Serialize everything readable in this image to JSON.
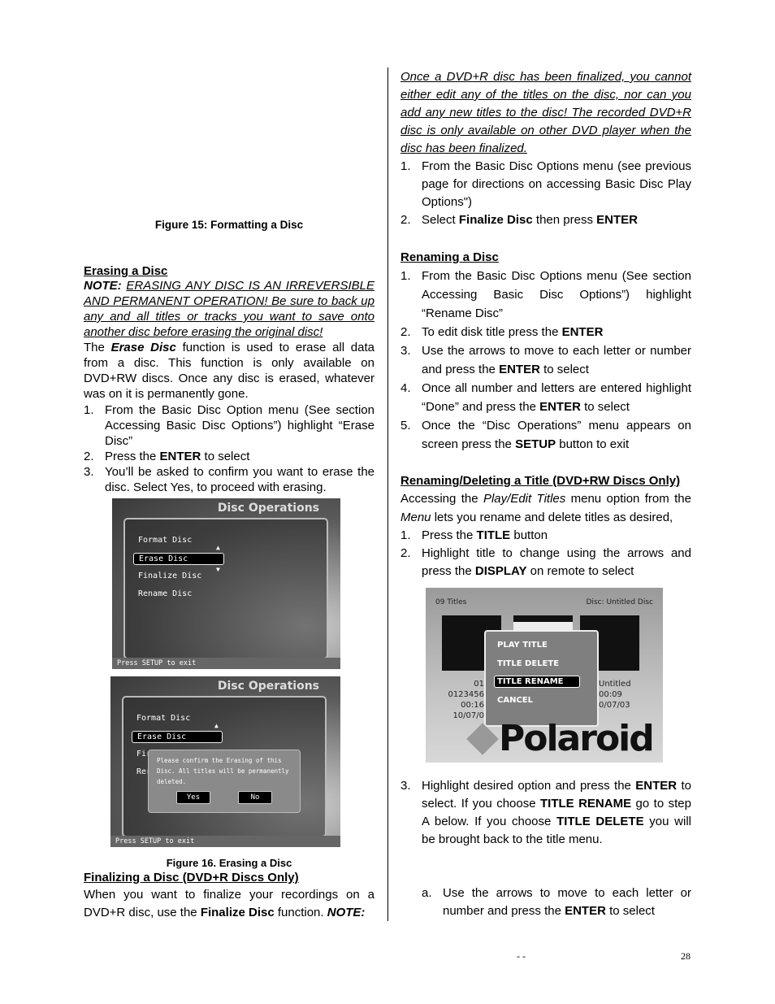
{
  "left": {
    "fig15_caption": "Figure 15: Formatting a Disc",
    "erasing": {
      "heading": "Erasing a Disc",
      "note": [
        [
          "NOTE:",
          "bi"
        ],
        [
          " ",
          ""
        ],
        [
          "ERASING ANY DISC IS AN IRREVERSIBLE AND PERMANENT OPERATION! Be sure to back up any and all titles or tracks you want to save onto another disc before erasing the original disc!",
          "iu"
        ]
      ],
      "body": [
        [
          "The ",
          ""
        ],
        [
          "Erase Disc",
          "bi"
        ],
        [
          " function is used to erase all data from a disc. This function is only available on DVD+RW discs.   Once any disc is erased, whatever was on it is permanently gone.",
          ""
        ]
      ],
      "steps": [
        {
          "n": "1.",
          "runs": [
            [
              "From the Basic Disc Option menu (See section Accessing Basic Disc Options”) highlight “Erase Disc”",
              ""
            ]
          ]
        },
        {
          "n": "2.",
          "runs": [
            [
              "Press the ",
              ""
            ],
            [
              "ENTER",
              "b"
            ],
            [
              " to select",
              ""
            ]
          ]
        },
        {
          "n": "3.",
          "runs": [
            [
              "You’ll be asked to confirm you want to erase the disc.   Select Yes, to proceed with erasing.",
              ""
            ]
          ]
        }
      ]
    },
    "screen1": {
      "title": "Disc Operations",
      "items": [
        "Format Disc",
        "Erase Disc",
        "Finalize Disc",
        "Rename Disc"
      ],
      "selected": "Erase Disc",
      "footer": "Press SETUP to exit"
    },
    "screen2": {
      "title": "Disc Operations",
      "items": [
        "Format Disc",
        "Erase Disc",
        "Fir",
        "Rer"
      ],
      "dialog": "Please confirm the Erasing of this Disc. All titles will be permanently deleted.",
      "yes": "Yes",
      "no": "No",
      "footer": "Press SETUP to exit"
    },
    "fig16_caption": "Figure 16. Erasing a Disc",
    "finalizing": {
      "heading": "Finalizing a Disc (DVD+R Discs Only)",
      "body": [
        [
          "When you want to finalize your recordings on a DVD+R disc, use the ",
          ""
        ],
        [
          "Finalize Disc",
          "b"
        ],
        [
          " function.   ",
          ""
        ],
        [
          "NOTE:",
          "bi"
        ]
      ]
    }
  },
  "right": {
    "finalize_note": [
      [
        "Once a DVD+R disc has been finalized, you cannot either edit any of the titles on the disc, nor can you add any new titles to the disc! The recorded DVD+R disc is only available on other DVD player when the disc has been finalized.",
        "iu"
      ]
    ],
    "finalize_steps": [
      {
        "n": "1.",
        "runs": [
          [
            "From the Basic Disc Options menu (see previous page for directions on accessing Basic Disc Play Options\")",
            ""
          ]
        ]
      },
      {
        "n": "2.",
        "runs": [
          [
            "Select ",
            ""
          ],
          [
            "Finalize Disc",
            "b"
          ],
          [
            " then press ",
            ""
          ],
          [
            "ENTER",
            "b"
          ]
        ]
      }
    ],
    "renaming": {
      "heading": "Renaming a Disc",
      "steps": [
        {
          "n": "1.",
          "runs": [
            [
              "From the Basic Disc Options menu (See section Accessing Basic Disc Options”) highlight “Rename Disc”",
              ""
            ]
          ]
        },
        {
          "n": "2.",
          "runs": [
            [
              "To edit disk title press the ",
              ""
            ],
            [
              "ENTER",
              "b"
            ]
          ]
        },
        {
          "n": "3.",
          "runs": [
            [
              "Use the arrows to move to each letter or number and press the ",
              ""
            ],
            [
              "ENTER",
              "b"
            ],
            [
              " to select",
              ""
            ]
          ]
        },
        {
          "n": "4.",
          "runs": [
            [
              "Once all number and letters are entered highlight “Done” and press the ",
              ""
            ],
            [
              "ENTER",
              "b"
            ],
            [
              " to select",
              ""
            ]
          ]
        },
        {
          "n": "5.",
          "runs": [
            [
              "Once the “Disc Operations” menu appears on screen press the ",
              ""
            ],
            [
              "SETUP",
              "b"
            ],
            [
              " button to exit",
              ""
            ]
          ]
        }
      ]
    },
    "title_section": {
      "heading": "Renaming/Deleting a Title (DVD+RW Discs Only)",
      "intro": [
        [
          "Accessing the ",
          ""
        ],
        [
          "Play/Edit Titles",
          "i"
        ],
        [
          " menu option from the ",
          ""
        ],
        [
          "Menu",
          "i"
        ],
        [
          " lets you rename and delete titles as desired,",
          ""
        ]
      ],
      "steps": [
        {
          "n": "1.",
          "runs": [
            [
              "Press the ",
              ""
            ],
            [
              "TITLE",
              "b"
            ],
            [
              " button",
              ""
            ]
          ]
        },
        {
          "n": "2.",
          "runs": [
            [
              "Highlight title to change using the arrows and press the ",
              ""
            ],
            [
              "DISPLAY",
              "b"
            ],
            [
              " on remote to select",
              ""
            ]
          ]
        }
      ],
      "steps2": [
        {
          "n": "3.",
          "runs": [
            [
              "Highlight desired option and press the ",
              ""
            ],
            [
              "ENTER",
              "b"
            ],
            [
              " to select.   If you choose ",
              ""
            ],
            [
              "TITLE RENAME",
              "b"
            ],
            [
              " go to step A below.   If you choose ",
              ""
            ],
            [
              "TITLE DELETE",
              "b"
            ],
            [
              " you will be brought back to the title menu.",
              ""
            ]
          ]
        }
      ],
      "substeps": [
        {
          "n": "a.",
          "runs": [
            [
              "Use the arrows to move to each letter or number and press the ",
              ""
            ],
            [
              "ENTER",
              "b"
            ],
            [
              " to select",
              ""
            ]
          ]
        }
      ]
    },
    "screen3": {
      "count": "09 Titles",
      "disc": "Disc: Untitled Disc",
      "menu": [
        "PLAY TITLE",
        "TITLE DELETE",
        "TITLE RENAME",
        "CANCEL"
      ],
      "selected": "TITLE RENAME",
      "left_info": [
        "01 0123456",
        "00:16",
        "10/07/0"
      ],
      "right_info": [
        "Untitled",
        "00:09",
        "0/07/03"
      ],
      "logo": "Polaroid"
    }
  },
  "footer": {
    "dashes": "-  -",
    "page_number": "28"
  }
}
